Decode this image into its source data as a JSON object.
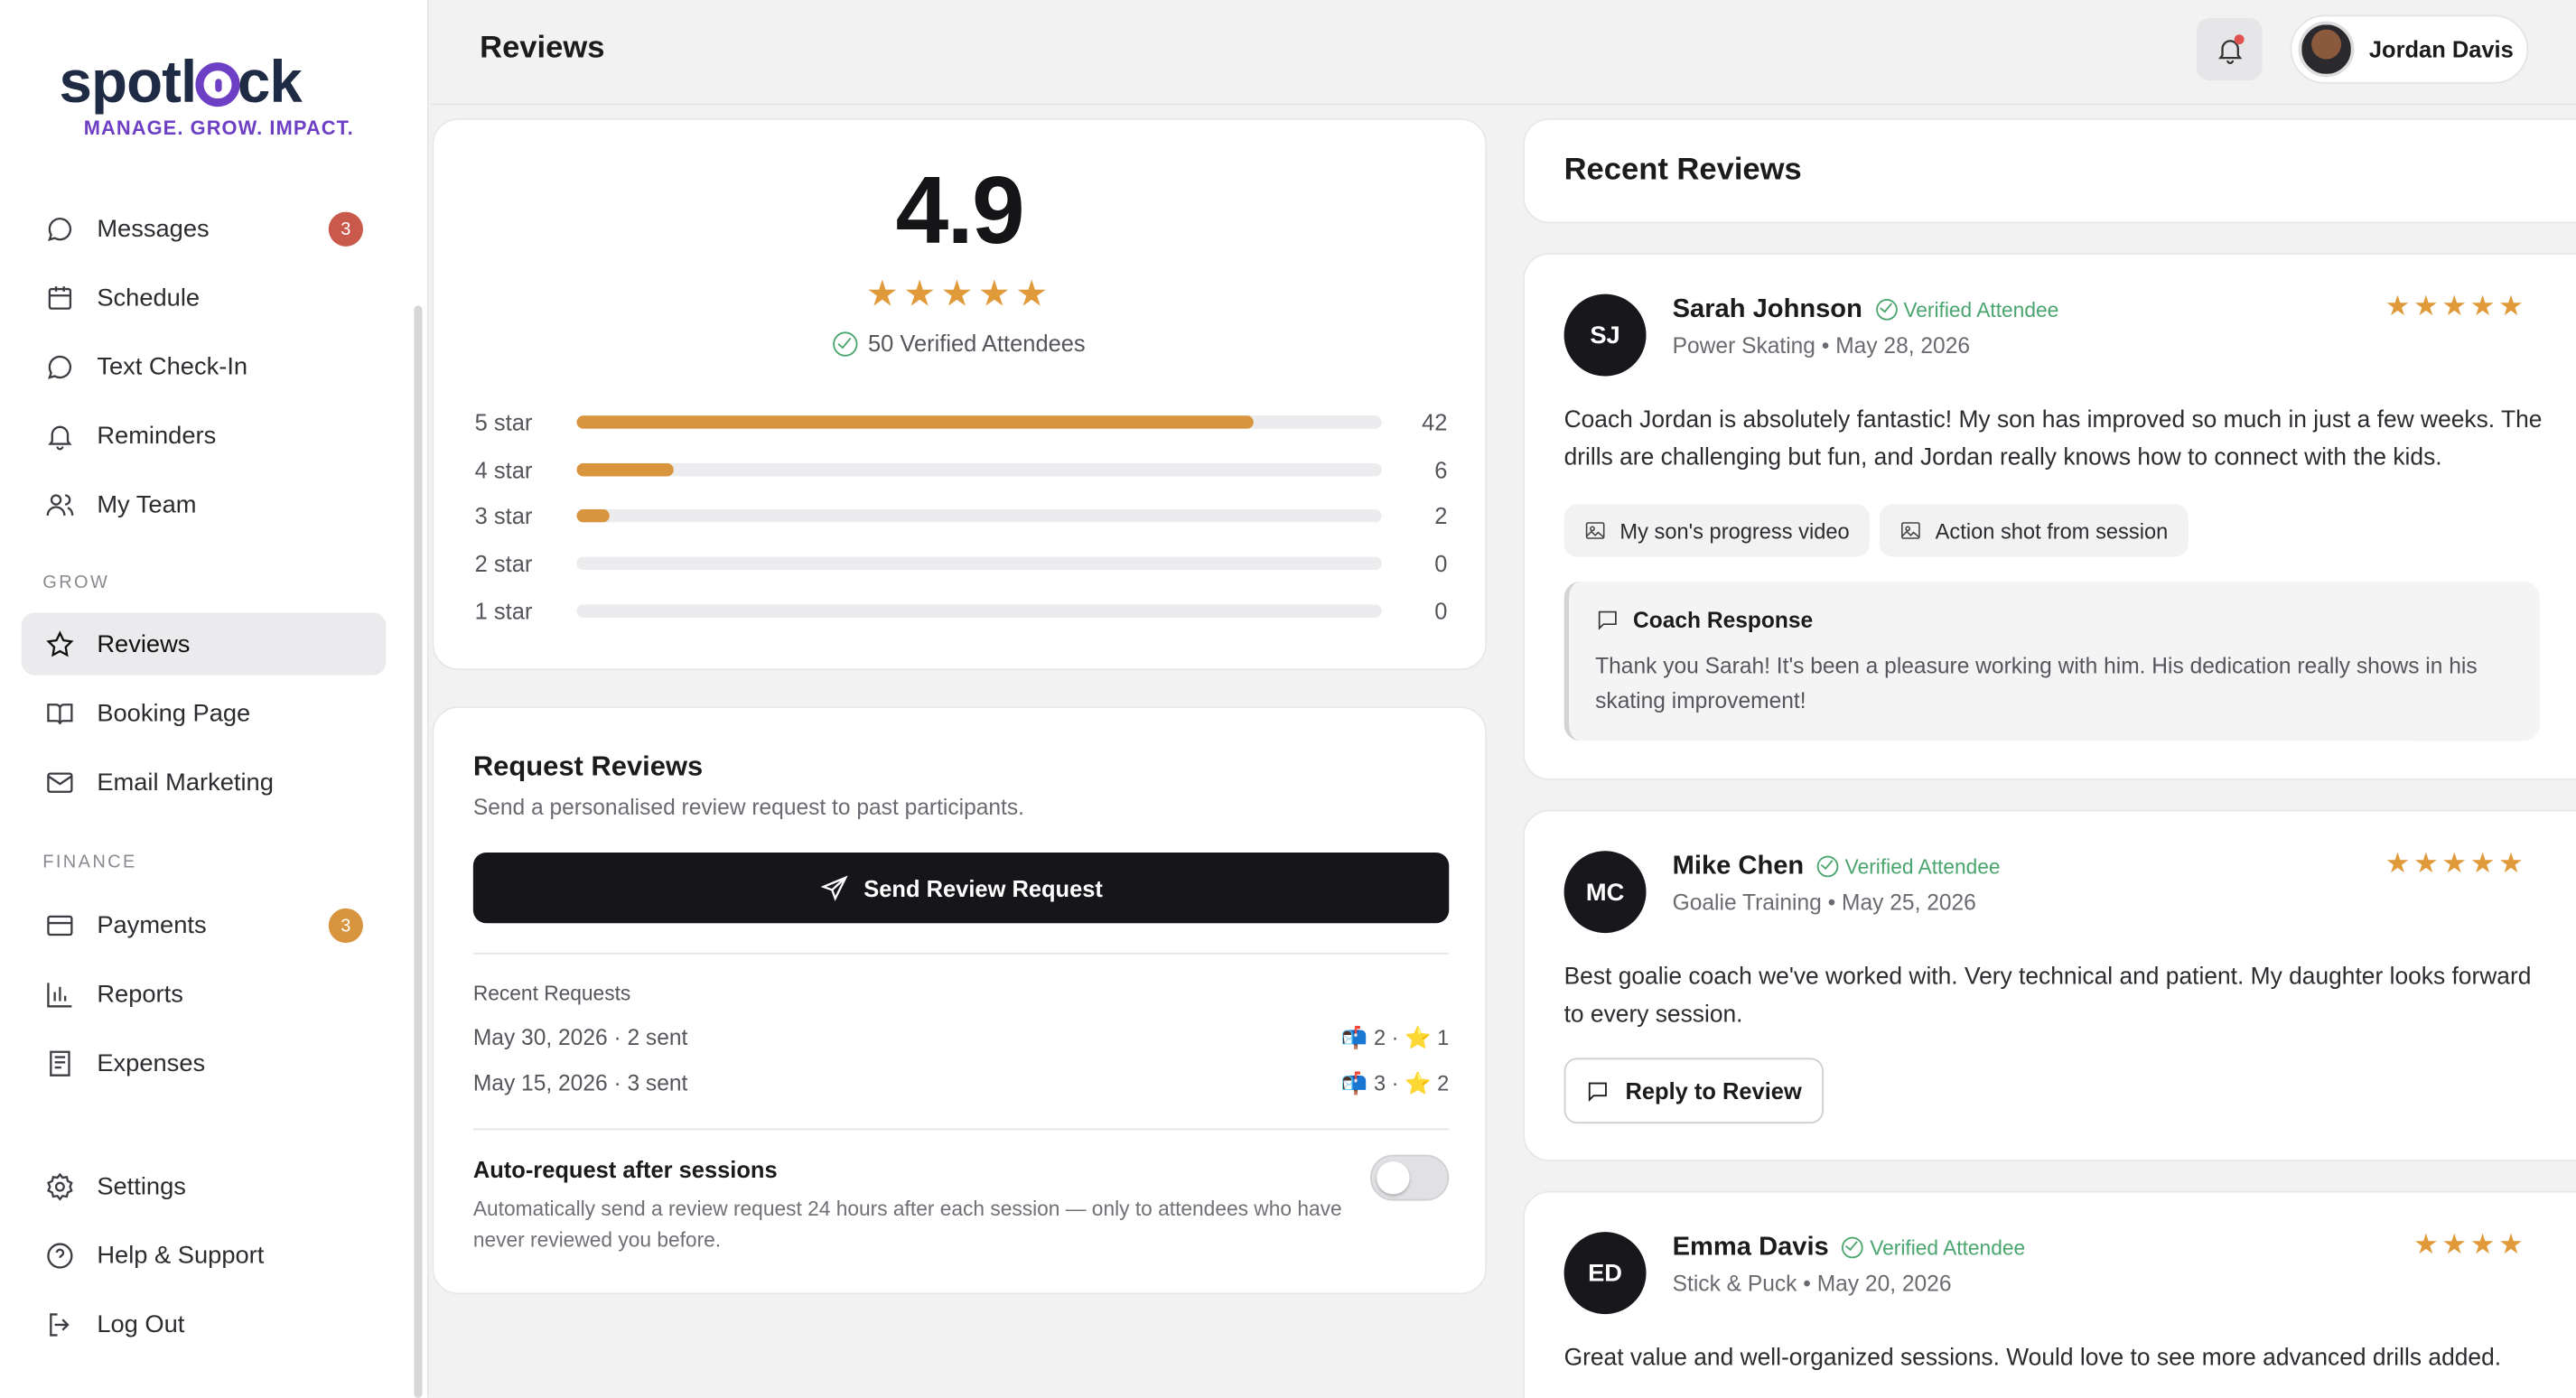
{
  "brand": {
    "logo_pre": "spotl",
    "logo_post": "ck",
    "tagline": "MANAGE. GROW. IMPACT.",
    "accent": "#6d3fc4"
  },
  "sidebar": {
    "main_items": [
      {
        "label": "Messages",
        "icon": "chat-bubble-icon",
        "badge": "3",
        "badge_color": "#c9594a"
      },
      {
        "label": "Schedule",
        "icon": "calendar-icon"
      },
      {
        "label": "Text Check-In",
        "icon": "chat-dots-icon"
      },
      {
        "label": "Reminders",
        "icon": "bell-icon"
      },
      {
        "label": "My Team",
        "icon": "users-icon"
      }
    ],
    "grow_label": "GROW",
    "grow_items": [
      {
        "label": "Reviews",
        "icon": "star-icon",
        "active": true
      },
      {
        "label": "Booking Page",
        "icon": "book-icon"
      },
      {
        "label": "Email Marketing",
        "icon": "mail-icon"
      }
    ],
    "finance_label": "FINANCE",
    "finance_items": [
      {
        "label": "Payments",
        "icon": "credit-card-icon",
        "badge": "3",
        "badge_color": "#d9943e"
      },
      {
        "label": "Reports",
        "icon": "bar-chart-icon"
      },
      {
        "label": "Expenses",
        "icon": "receipt-icon"
      }
    ],
    "bottom_items": [
      {
        "label": "Settings",
        "icon": "gear-icon"
      },
      {
        "label": "Help & Support",
        "icon": "help-circle-icon"
      },
      {
        "label": "Log Out",
        "icon": "logout-icon"
      }
    ]
  },
  "header": {
    "title": "Reviews",
    "user_name": "Jordan Davis"
  },
  "rating": {
    "score": "4.9",
    "stars": "★★★★★",
    "verified_text": "50 Verified Attendees",
    "distribution": [
      {
        "label": "5 star",
        "count": "42",
        "fraction": 0.84
      },
      {
        "label": "4 star",
        "count": "6",
        "fraction": 0.12
      },
      {
        "label": "3 star",
        "count": "2",
        "fraction": 0.04
      },
      {
        "label": "2 star",
        "count": "0",
        "fraction": 0
      },
      {
        "label": "1 star",
        "count": "0",
        "fraction": 0
      }
    ],
    "star_color": "#e09a3a"
  },
  "request": {
    "title": "Request Reviews",
    "subtitle": "Send a personalised review request to past participants.",
    "button_label": "Send Review Request",
    "recent_label": "Recent Requests",
    "recent": [
      {
        "date": "May 30, 2026 · 2 sent",
        "stat": "📬 2 · ⭐ 1"
      },
      {
        "date": "May 15, 2026 · 3 sent",
        "stat": "📬 3 · ⭐ 2"
      }
    ],
    "auto_title": "Auto-request after sessions",
    "auto_desc": "Automatically send a review request 24 hours after each session — only to attendees who have never reviewed you before.",
    "auto_enabled": false
  },
  "recent_reviews": {
    "title": "Recent Reviews",
    "verified_label": "Verified Attendee",
    "reviews": [
      {
        "initials": "SJ",
        "name": "Sarah Johnson",
        "meta": "Power Skating • May 28, 2026",
        "stars": "★★★★★",
        "text": "Coach Jordan is absolutely fantastic! My son has improved so much in just a few weeks. The drills are challenging but fun, and Jordan really knows how to connect with the kids.",
        "attachments": [
          "My son's progress video",
          "Action shot from session"
        ],
        "response_title": "Coach Response",
        "response_text": "Thank you Sarah! It's been a pleasure working with him. His dedication really shows in his skating improvement!"
      },
      {
        "initials": "MC",
        "name": "Mike Chen",
        "meta": "Goalie Training • May 25, 2026",
        "stars": "★★★★★",
        "text": "Best goalie coach we've worked with. Very technical and patient. My daughter looks forward to every session.",
        "reply_label": "Reply to Review"
      },
      {
        "initials": "ED",
        "name": "Emma Davis",
        "meta": "Stick & Puck • May 20, 2026",
        "stars": "★★★★",
        "text": "Great value and well-organized sessions. Would love to see more advanced drills added."
      }
    ]
  }
}
